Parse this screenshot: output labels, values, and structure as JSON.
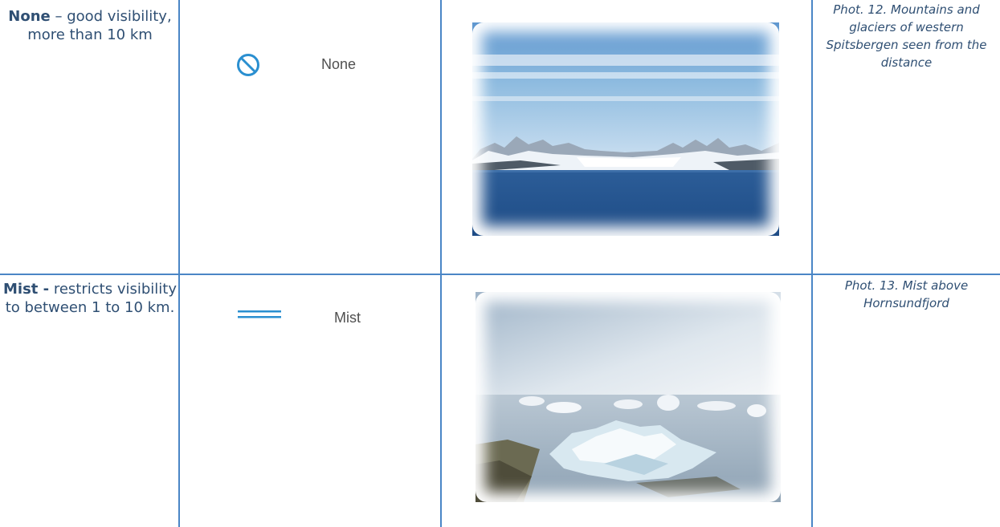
{
  "rows": [
    {
      "desc_bold": "None",
      "desc_rest": " – good visibility, more than 10 km",
      "symbol_icon": "circle-slash-icon",
      "symbol_label": "None",
      "caption": "Phot. 12. Mountains and glaciers of western Spitsbergen seen from the distance"
    },
    {
      "desc_bold": "Mist -",
      "desc_rest": " restricts visibility to between 1 to 10 km.",
      "symbol_icon": "double-line-icon",
      "symbol_label": "Mist",
      "caption": "Phot. 13. Mist above Hornsundfjord"
    }
  ],
  "colors": {
    "border": "#4a86c6",
    "text": "#2f4f73",
    "icon": "#2a8fd0"
  }
}
